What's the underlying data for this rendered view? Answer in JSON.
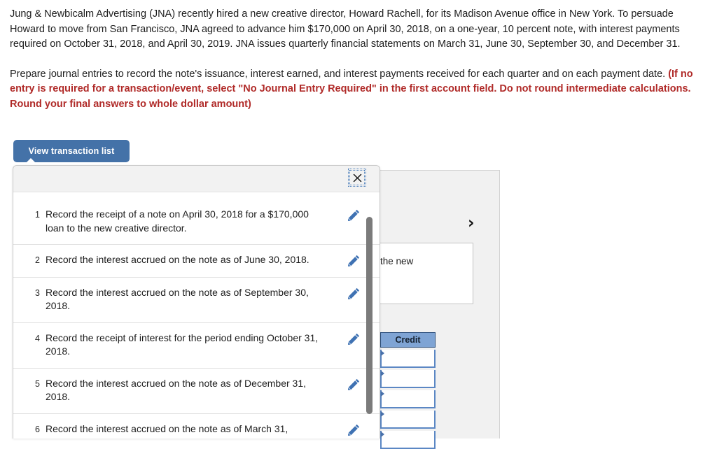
{
  "problem": {
    "paragraph1": "Jung & Newbicalm Advertising (JNA) recently hired a new creative director, Howard Rachell, for its Madison Avenue office in New York. To persuade Howard to move from San Francisco, JNA agreed to advance him $170,000 on April 30, 2018, on a one-year, 10 percent note, with interest payments required on October 31, 2018, and April 30, 2019. JNA issues quarterly financial statements on March 31, June 30, September 30, and December 31.",
    "paragraph2_plain": "Prepare journal entries to record the note's issuance, interest earned, and interest payments received for each quarter and on each payment date. ",
    "paragraph2_red": "(If no entry is required for a transaction/event, select \"No Journal Entry Required\" in the first account field. Do not round intermediate calculations. Round your final answers to whole dollar amount)"
  },
  "toolbar": {
    "view_transaction_list_label": "View transaction list"
  },
  "modal": {
    "close_icon": "close-icon",
    "rows": [
      {
        "num": "1",
        "text": "Record the receipt of a note on April 30, 2018 for a $170,000 loan to the new creative director.",
        "edit_icon": "pencil-icon"
      },
      {
        "num": "2",
        "text": "Record the interest accrued on the note as of June 30, 2018.",
        "edit_icon": "pencil-icon"
      },
      {
        "num": "3",
        "text": "Record the interest accrued on the note as of September 30, 2018.",
        "edit_icon": "pencil-icon"
      },
      {
        "num": "4",
        "text": "Record the receipt of interest for the period ending October 31, 2018.",
        "edit_icon": "pencil-icon"
      },
      {
        "num": "5",
        "text": "Record the interest accrued on the note as of December 31, 2018.",
        "edit_icon": "pencil-icon"
      },
      {
        "num": "6",
        "text": "Record the interest accrued on the note as of March 31,",
        "edit_icon": "pencil-icon"
      }
    ]
  },
  "journal_panel": {
    "next_chevron": "›",
    "account_text": "the new",
    "credit_header": "Credit",
    "credit_cells": [
      "",
      "",
      "",
      "",
      ""
    ]
  },
  "colors": {
    "accent_blue": "#4472a8",
    "instruction_red": "#b02a28",
    "credit_header_blue": "#7fa4d4",
    "cell_border_blue": "#5b87c4",
    "scrollbar_gray": "#7b7b7b"
  }
}
